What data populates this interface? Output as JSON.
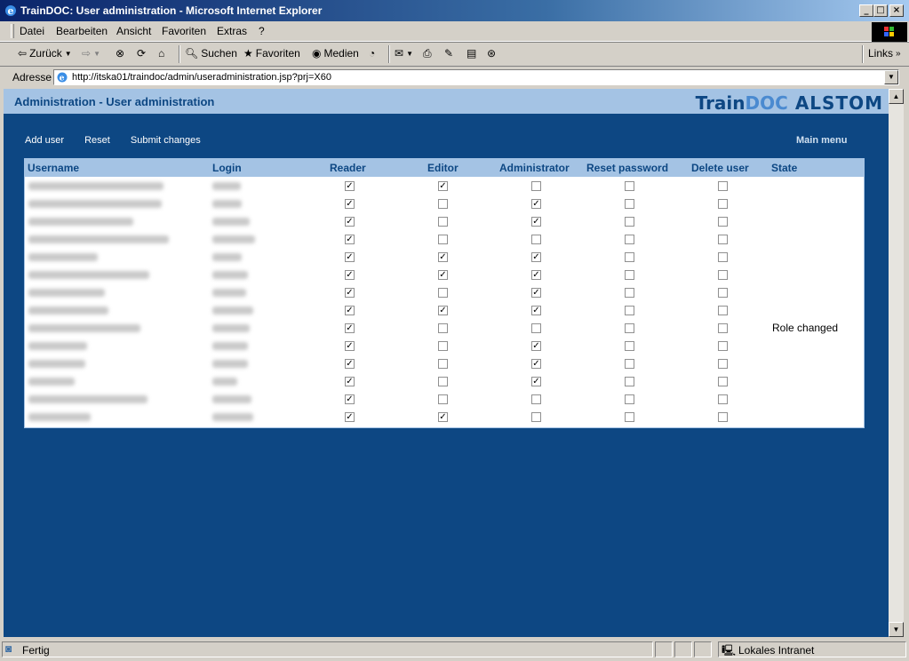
{
  "window": {
    "title": "TrainDOC: User administration - Microsoft Internet Explorer"
  },
  "menu": [
    "Datei",
    "Bearbeiten",
    "Ansicht",
    "Favoriten",
    "Extras",
    "?"
  ],
  "toolbar": {
    "back": "Zurück",
    "search": "Suchen",
    "favorites": "Favoriten",
    "media": "Medien",
    "links": "Links"
  },
  "address": {
    "label": "Adresse",
    "url": "http://itska01/traindoc/admin/useradministration.jsp?prj=X60"
  },
  "page": {
    "title": "Administration - User administration",
    "logo_train": "Train",
    "logo_doc": "DOC",
    "logo_alstom": "ALSTOM",
    "actions": [
      "Add user",
      "Reset",
      "Submit changes"
    ],
    "main_menu": "Main menu"
  },
  "table": {
    "headers": [
      "Username",
      "Login",
      "Reader",
      "Editor",
      "Administrator",
      "Reset password",
      "Delete user",
      "State"
    ],
    "rows": [
      {
        "reader": true,
        "editor": true,
        "admin": false,
        "reset": false,
        "delete": false,
        "state": ""
      },
      {
        "reader": true,
        "editor": false,
        "admin": true,
        "reset": false,
        "delete": false,
        "state": ""
      },
      {
        "reader": true,
        "editor": false,
        "admin": true,
        "reset": false,
        "delete": false,
        "state": ""
      },
      {
        "reader": true,
        "editor": false,
        "admin": false,
        "reset": false,
        "delete": false,
        "state": ""
      },
      {
        "reader": true,
        "editor": true,
        "admin": true,
        "reset": false,
        "delete": false,
        "state": ""
      },
      {
        "reader": true,
        "editor": true,
        "admin": true,
        "reset": false,
        "delete": false,
        "state": ""
      },
      {
        "reader": true,
        "editor": false,
        "admin": true,
        "reset": false,
        "delete": false,
        "state": ""
      },
      {
        "reader": true,
        "editor": true,
        "admin": true,
        "reset": false,
        "delete": false,
        "state": ""
      },
      {
        "reader": true,
        "editor": false,
        "admin": false,
        "reset": false,
        "delete": false,
        "state": "Role changed"
      },
      {
        "reader": true,
        "editor": false,
        "admin": true,
        "reset": false,
        "delete": false,
        "state": ""
      },
      {
        "reader": true,
        "editor": false,
        "admin": true,
        "reset": false,
        "delete": false,
        "state": ""
      },
      {
        "reader": true,
        "editor": false,
        "admin": true,
        "reset": false,
        "delete": false,
        "state": ""
      },
      {
        "reader": true,
        "editor": false,
        "admin": false,
        "reset": false,
        "delete": false,
        "state": ""
      },
      {
        "reader": true,
        "editor": true,
        "admin": false,
        "reset": false,
        "delete": false,
        "state": ""
      }
    ]
  },
  "status": {
    "left": "Fertig",
    "zone": "Lokales Intranet"
  },
  "colors": {
    "page_bg": "#0d4783",
    "header_bg": "#a4c3e4",
    "title_blue": "#0d4783"
  }
}
